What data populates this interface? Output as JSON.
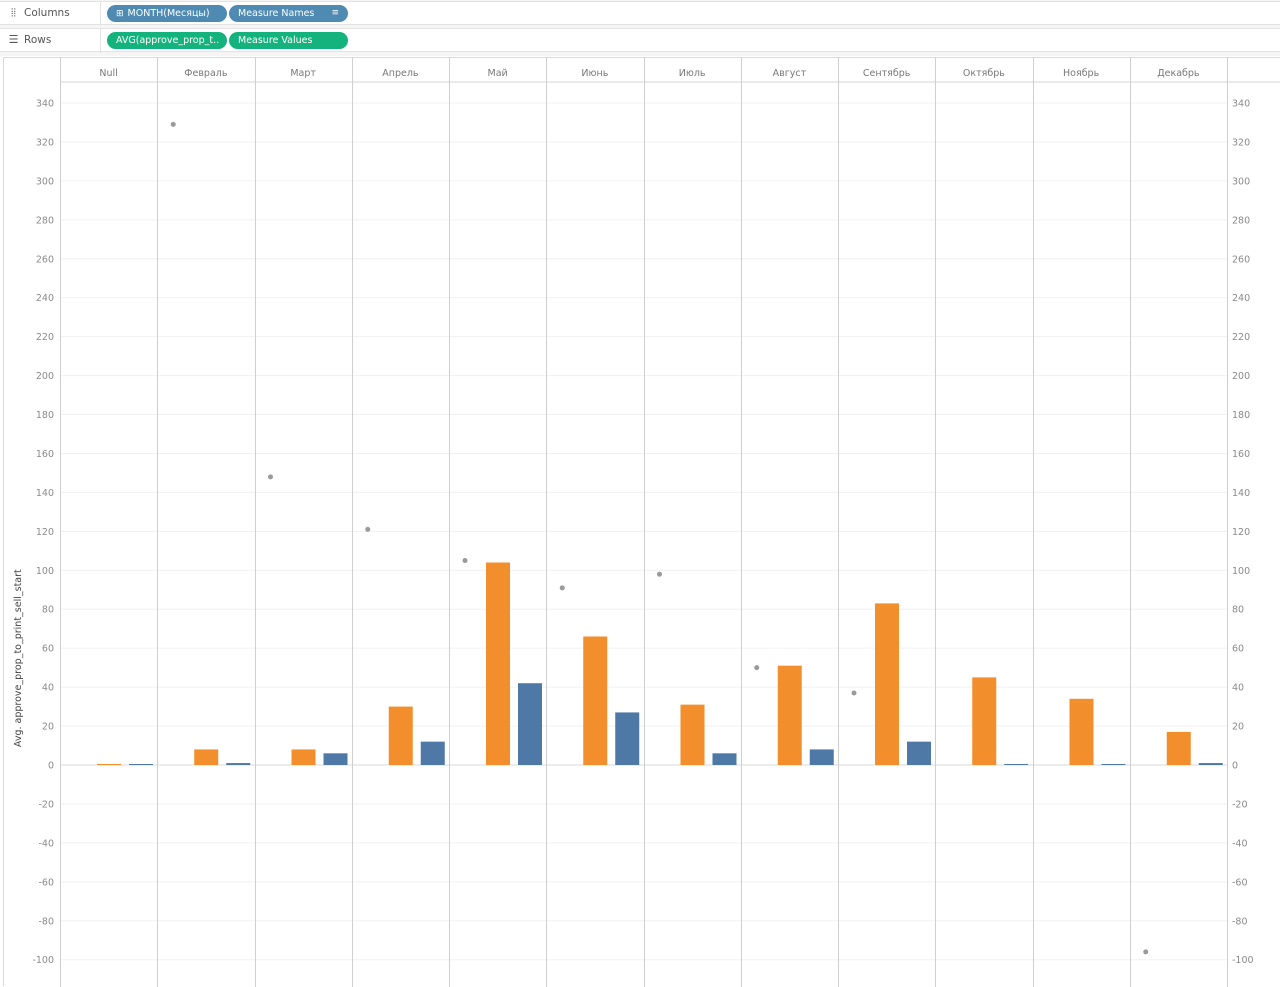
{
  "shelves": {
    "columns": {
      "label": "Columns",
      "icon": "columns-icon",
      "pills": [
        {
          "label": "MONTH(Месяцы)",
          "color": "#4e8ab2",
          "icon": "expand-plus-icon"
        },
        {
          "label": "Measure Names",
          "color": "#4e8ab2",
          "icon": "sort-icon"
        }
      ]
    },
    "rows": {
      "label": "Rows",
      "icon": "rows-icon",
      "pills": [
        {
          "label": "AVG(approve_prop_t..",
          "color": "#14b37d"
        },
        {
          "label": "Measure Values",
          "color": "#14b37d"
        }
      ]
    }
  },
  "chart_data": {
    "type": "bar",
    "ylabel": "Avg. approve_prop_to_print_sell_start",
    "ylim": [
      -110,
      350
    ],
    "ticks": [
      340,
      320,
      300,
      280,
      260,
      240,
      220,
      200,
      180,
      160,
      140,
      120,
      100,
      80,
      60,
      40,
      20,
      0,
      -20,
      -40,
      -60,
      -80,
      -100
    ],
    "grid": true,
    "dual_axis": true,
    "categories": [
      "Null",
      "Февраль",
      "Март",
      "Апрель",
      "Май",
      "Июнь",
      "Июль",
      "Август",
      "Сентябрь",
      "Октябрь",
      "Ноябрь",
      "Декабрь"
    ],
    "series": [
      {
        "type": "bar",
        "color": "#f28e2b",
        "values": [
          0,
          8,
          8,
          30,
          104,
          66,
          31,
          51,
          83,
          45,
          34,
          17
        ]
      },
      {
        "type": "bar",
        "color": "#4e79a7",
        "values": [
          0,
          1,
          6,
          12,
          42,
          27,
          6,
          8,
          12,
          0,
          0,
          1
        ]
      },
      {
        "type": "scatter",
        "color": "#9a9a9a",
        "values": [
          null,
          329,
          148,
          121,
          105,
          91,
          98,
          50,
          37,
          null,
          null,
          -96
        ]
      }
    ]
  }
}
